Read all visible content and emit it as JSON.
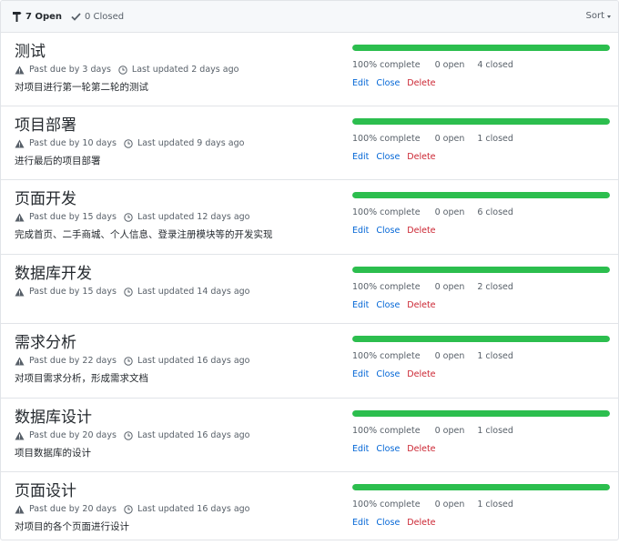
{
  "header": {
    "open_label": "7 Open",
    "closed_label": "0 Closed",
    "sort_label": "Sort"
  },
  "milestones": [
    {
      "title": "测试",
      "due": "Past due by 3 days",
      "updated": "Last updated 2 days ago",
      "description": "对项目进行第一轮第二轮的测试",
      "percent": "100% complete",
      "open": "0 open",
      "closed": "4 closed",
      "progress": 1.0
    },
    {
      "title": "项目部署",
      "due": "Past due by 10 days",
      "updated": "Last updated 9 days ago",
      "description": "进行最后的项目部署",
      "percent": "100% complete",
      "open": "0 open",
      "closed": "1 closed",
      "progress": 1.0
    },
    {
      "title": "页面开发",
      "due": "Past due by 15 days",
      "updated": "Last updated 12 days ago",
      "description": "完成首页、二手商城、个人信息、登录注册模块等的开发实现",
      "percent": "100% complete",
      "open": "0 open",
      "closed": "6 closed",
      "progress": 1.0
    },
    {
      "title": "数据库开发",
      "due": "Past due by 15 days",
      "updated": "Last updated 14 days ago",
      "description": "",
      "percent": "100% complete",
      "open": "0 open",
      "closed": "2 closed",
      "progress": 1.0
    },
    {
      "title": "需求分析",
      "due": "Past due by 22 days",
      "updated": "Last updated 16 days ago",
      "description": "对项目需求分析，形成需求文档",
      "percent": "100% complete",
      "open": "0 open",
      "closed": "1 closed",
      "progress": 1.0
    },
    {
      "title": "数据库设计",
      "due": "Past due by 20 days",
      "updated": "Last updated 16 days ago",
      "description": "项目数据库的设计",
      "percent": "100% complete",
      "open": "0 open",
      "closed": "1 closed",
      "progress": 1.0
    },
    {
      "title": "页面设计",
      "due": "Past due by 20 days",
      "updated": "Last updated 16 days ago",
      "description": "对项目的各个页面进行设计",
      "percent": "100% complete",
      "open": "0 open",
      "closed": "1 closed",
      "progress": 1.0
    }
  ],
  "actions": {
    "edit": "Edit",
    "close": "Close",
    "delete": "Delete"
  },
  "colors": {
    "progress": "#2cbe4e",
    "link": "#0366d6",
    "danger": "#cb2431"
  },
  "icons": {
    "open": "milestone-icon",
    "closed": "check-icon",
    "due": "alert-icon",
    "updated": "clock-icon"
  }
}
